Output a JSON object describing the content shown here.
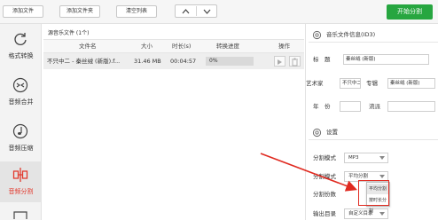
{
  "toolbar": {
    "add_file": "添加文件",
    "add_folder": "添加文件夹",
    "clear_list": "清空列表",
    "move_up_icon": "chevron-up",
    "move_down_icon": "chevron-down",
    "start": "开始分割"
  },
  "sidebar": {
    "items": [
      {
        "label": "格式转换",
        "icon": "refresh-icon"
      },
      {
        "label": "音频合并",
        "icon": "merge-icon"
      },
      {
        "label": "音频压缩",
        "icon": "compress-icon"
      },
      {
        "label": "音频分割",
        "icon": "split-icon",
        "active": true
      }
    ]
  },
  "file_list": {
    "header": "源音乐文件 (1个)",
    "columns": [
      "文件名",
      "大小",
      "时长(s)",
      "转换进度",
      "操作"
    ],
    "rows": [
      {
        "name": "不只中二 - 秦丝绒 (新版).f...",
        "size": "31.46 MB",
        "duration": "00:04:57",
        "progress": "0%",
        "progress_fraction": 0
      }
    ]
  },
  "info": {
    "header": "音乐文件信息(ID3)",
    "title_label": "标　题",
    "title_value": "秦丝绒 (新版)",
    "artist_label": "艺术家",
    "artist_value": "不只中二",
    "album_label": "专辑",
    "album_value": "秦丝绒 (新版)",
    "year_label": "年　份",
    "genre_label": "流派"
  },
  "settings": {
    "header": "设置",
    "split_mode_label": "分割模式",
    "split_mode_value": "MP3",
    "split_way_label": "分割模式",
    "split_way_value": "平均分割",
    "split_count_label": "分割份数",
    "output_dir_label": "输出目录",
    "output_dir_value": "自定义目录",
    "dropdown_options": [
      "平均分割",
      "按时长分割"
    ]
  },
  "colors": {
    "accent_green": "#27a640",
    "annotation_red": "#e02a20",
    "active_nav": "#e23a2e"
  }
}
